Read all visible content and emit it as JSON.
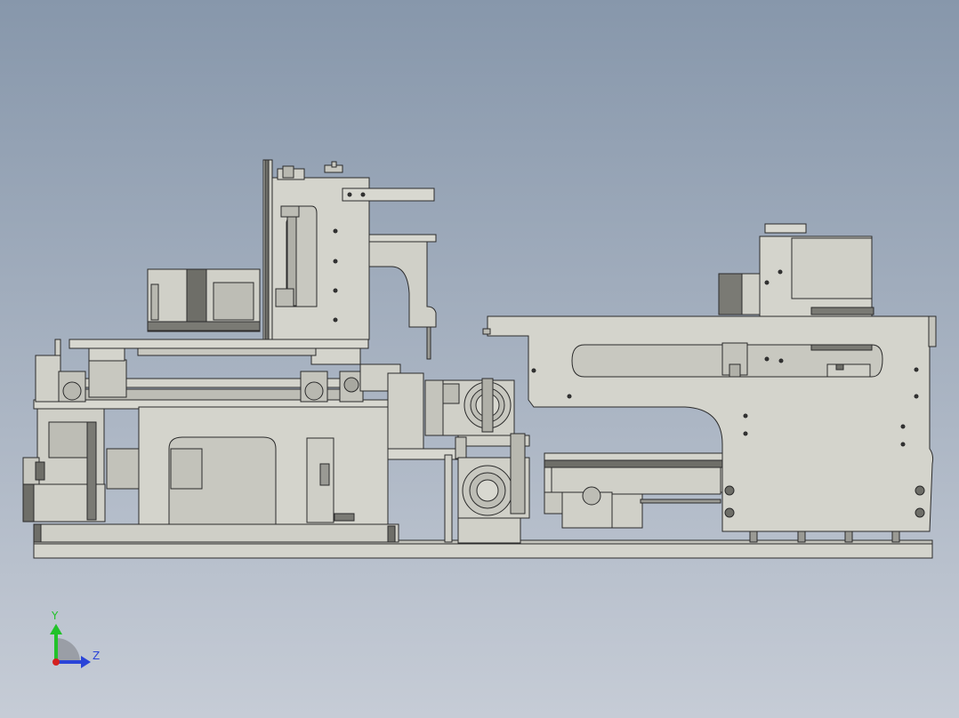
{
  "viewport": {
    "background_top": "#8797ab",
    "background_bottom": "#c6ccd6"
  },
  "model": {
    "part_fill": "#d4d4cc",
    "part_shade": "#b9b9b0",
    "part_dark": "#6e6e68",
    "edge_color": "#2b2b2b"
  },
  "triad": {
    "y_label": "Y",
    "z_label": "Z",
    "y_axis_color": "#22c22a",
    "z_axis_color": "#2a44d8",
    "x_axis_color": "#d42020"
  }
}
